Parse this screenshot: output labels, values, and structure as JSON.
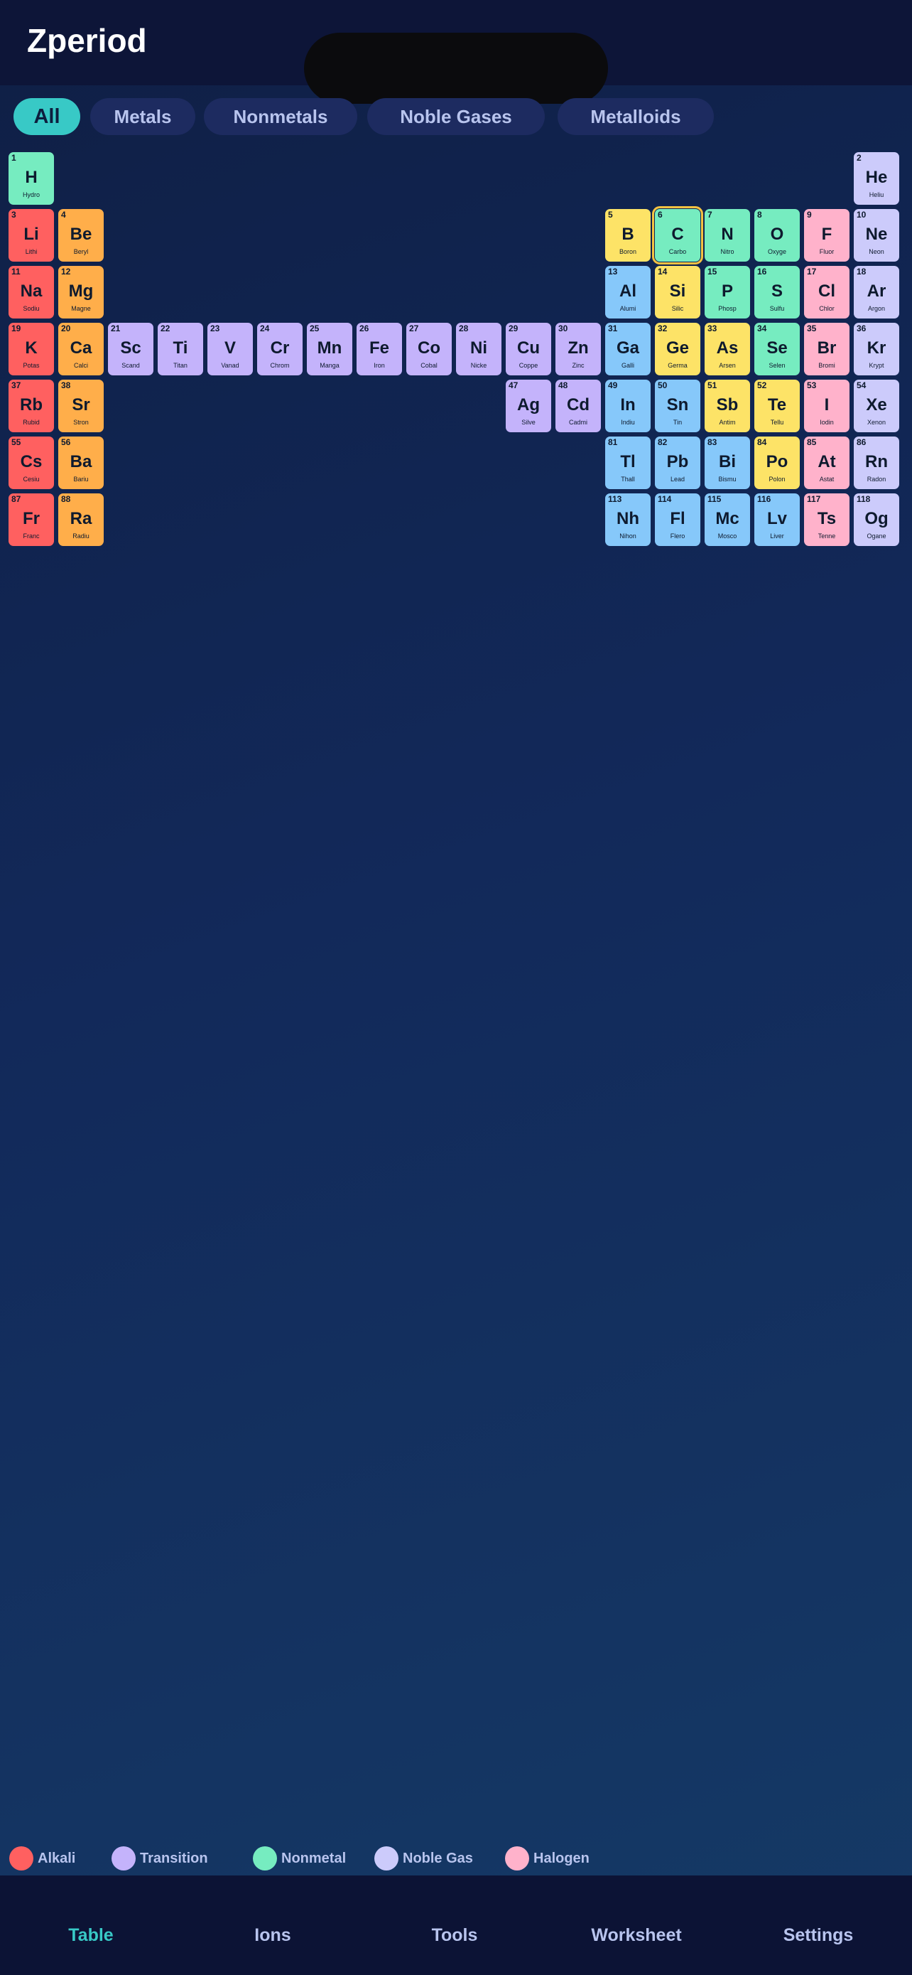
{
  "app": {
    "title": "Zperiod"
  },
  "filters": [
    {
      "label": "All",
      "active": true
    },
    {
      "label": "Metals",
      "active": false
    },
    {
      "label": "Nonmetals",
      "active": false
    },
    {
      "label": "Noble Gases",
      "active": false
    },
    {
      "label": "Metalloids",
      "active": false
    }
  ],
  "colors": {
    "alkali": "#ff6060",
    "alkaline": "#ffae4a",
    "transition": "#c4b3fb",
    "post": "#86c8fa",
    "metalloid": "#fde367",
    "nonmetal": "#76ecc0",
    "halogen": "#ffb2cb",
    "noble": "#cccbfb"
  },
  "selected_element": "C",
  "elements": [
    {
      "n": "1",
      "s": "H",
      "name": "Hydro",
      "c": "nonmetal",
      "row": 1,
      "col": 1
    },
    {
      "n": "2",
      "s": "He",
      "name": "Heliu",
      "c": "noble",
      "row": 1,
      "col": 18
    },
    {
      "n": "3",
      "s": "Li",
      "name": "Lithi",
      "c": "alkali",
      "row": 2,
      "col": 1
    },
    {
      "n": "4",
      "s": "Be",
      "name": "Beryl",
      "c": "alkaline",
      "row": 2,
      "col": 2
    },
    {
      "n": "5",
      "s": "B",
      "name": "Boron",
      "c": "metalloid",
      "row": 2,
      "col": 13
    },
    {
      "n": "6",
      "s": "C",
      "name": "Carbo",
      "c": "nonmetal",
      "row": 2,
      "col": 14
    },
    {
      "n": "7",
      "s": "N",
      "name": "Nitro",
      "c": "nonmetal",
      "row": 2,
      "col": 15
    },
    {
      "n": "8",
      "s": "O",
      "name": "Oxyge",
      "c": "nonmetal",
      "row": 2,
      "col": 16
    },
    {
      "n": "9",
      "s": "F",
      "name": "Fluor",
      "c": "halogen",
      "row": 2,
      "col": 17
    },
    {
      "n": "10",
      "s": "Ne",
      "name": "Neon",
      "c": "noble",
      "row": 2,
      "col": 18
    },
    {
      "n": "11",
      "s": "Na",
      "name": "Sodiu",
      "c": "alkali",
      "row": 3,
      "col": 1
    },
    {
      "n": "12",
      "s": "Mg",
      "name": "Magne",
      "c": "alkaline",
      "row": 3,
      "col": 2
    },
    {
      "n": "13",
      "s": "Al",
      "name": "Alumi",
      "c": "post",
      "row": 3,
      "col": 13
    },
    {
      "n": "14",
      "s": "Si",
      "name": "Silic",
      "c": "metalloid",
      "row": 3,
      "col": 14
    },
    {
      "n": "15",
      "s": "P",
      "name": "Phosp",
      "c": "nonmetal",
      "row": 3,
      "col": 15
    },
    {
      "n": "16",
      "s": "S",
      "name": "Sulfu",
      "c": "nonmetal",
      "row": 3,
      "col": 16
    },
    {
      "n": "17",
      "s": "Cl",
      "name": "Chlor",
      "c": "halogen",
      "row": 3,
      "col": 17
    },
    {
      "n": "18",
      "s": "Ar",
      "name": "Argon",
      "c": "noble",
      "row": 3,
      "col": 18
    },
    {
      "n": "19",
      "s": "K",
      "name": "Potas",
      "c": "alkali",
      "row": 4,
      "col": 1
    },
    {
      "n": "20",
      "s": "Ca",
      "name": "Calci",
      "c": "alkaline",
      "row": 4,
      "col": 2
    },
    {
      "n": "21",
      "s": "Sc",
      "name": "Scand",
      "c": "transition",
      "row": 4,
      "col": 3
    },
    {
      "n": "22",
      "s": "Ti",
      "name": "Titan",
      "c": "transition",
      "row": 4,
      "col": 4
    },
    {
      "n": "23",
      "s": "V",
      "name": "Vanad",
      "c": "transition",
      "row": 4,
      "col": 5
    },
    {
      "n": "24",
      "s": "Cr",
      "name": "Chrom",
      "c": "transition",
      "row": 4,
      "col": 6
    },
    {
      "n": "25",
      "s": "Mn",
      "name": "Manga",
      "c": "transition",
      "row": 4,
      "col": 7
    },
    {
      "n": "26",
      "s": "Fe",
      "name": "Iron",
      "c": "transition",
      "row": 4,
      "col": 8
    },
    {
      "n": "27",
      "s": "Co",
      "name": "Cobal",
      "c": "transition",
      "row": 4,
      "col": 9
    },
    {
      "n": "28",
      "s": "Ni",
      "name": "Nicke",
      "c": "transition",
      "row": 4,
      "col": 10
    },
    {
      "n": "29",
      "s": "Cu",
      "name": "Coppe",
      "c": "transition",
      "row": 4,
      "col": 11
    },
    {
      "n": "30",
      "s": "Zn",
      "name": "Zinc",
      "c": "transition",
      "row": 4,
      "col": 12
    },
    {
      "n": "31",
      "s": "Ga",
      "name": "Galli",
      "c": "post",
      "row": 4,
      "col": 13
    },
    {
      "n": "32",
      "s": "Ge",
      "name": "Germa",
      "c": "metalloid",
      "row": 4,
      "col": 14
    },
    {
      "n": "33",
      "s": "As",
      "name": "Arsen",
      "c": "metalloid",
      "row": 4,
      "col": 15
    },
    {
      "n": "34",
      "s": "Se",
      "name": "Selen",
      "c": "nonmetal",
      "row": 4,
      "col": 16
    },
    {
      "n": "35",
      "s": "Br",
      "name": "Bromi",
      "c": "halogen",
      "row": 4,
      "col": 17
    },
    {
      "n": "36",
      "s": "Kr",
      "name": "Krypt",
      "c": "noble",
      "row": 4,
      "col": 18
    },
    {
      "n": "37",
      "s": "Rb",
      "name": "Rubid",
      "c": "alkali",
      "row": 5,
      "col": 1
    },
    {
      "n": "38",
      "s": "Sr",
      "name": "Stron",
      "c": "alkaline",
      "row": 5,
      "col": 2
    },
    {
      "n": "47",
      "s": "Ag",
      "name": "Silve",
      "c": "transition",
      "row": 5,
      "col": 11
    },
    {
      "n": "48",
      "s": "Cd",
      "name": "Cadmi",
      "c": "transition",
      "row": 5,
      "col": 12
    },
    {
      "n": "49",
      "s": "In",
      "name": "Indiu",
      "c": "post",
      "row": 5,
      "col": 13
    },
    {
      "n": "50",
      "s": "Sn",
      "name": "Tin",
      "c": "post",
      "row": 5,
      "col": 14
    },
    {
      "n": "51",
      "s": "Sb",
      "name": "Antim",
      "c": "metalloid",
      "row": 5,
      "col": 15
    },
    {
      "n": "52",
      "s": "Te",
      "name": "Tellu",
      "c": "metalloid",
      "row": 5,
      "col": 16
    },
    {
      "n": "53",
      "s": "I",
      "name": "Iodin",
      "c": "halogen",
      "row": 5,
      "col": 17
    },
    {
      "n": "54",
      "s": "Xe",
      "name": "Xenon",
      "c": "noble",
      "row": 5,
      "col": 18
    },
    {
      "n": "55",
      "s": "Cs",
      "name": "Cesiu",
      "c": "alkali",
      "row": 6,
      "col": 1
    },
    {
      "n": "56",
      "s": "Ba",
      "name": "Bariu",
      "c": "alkaline",
      "row": 6,
      "col": 2
    },
    {
      "n": "81",
      "s": "Tl",
      "name": "Thall",
      "c": "post",
      "row": 6,
      "col": 13
    },
    {
      "n": "82",
      "s": "Pb",
      "name": "Lead",
      "c": "post",
      "row": 6,
      "col": 14
    },
    {
      "n": "83",
      "s": "Bi",
      "name": "Bismu",
      "c": "post",
      "row": 6,
      "col": 15
    },
    {
      "n": "84",
      "s": "Po",
      "name": "Polon",
      "c": "metalloid",
      "row": 6,
      "col": 16
    },
    {
      "n": "85",
      "s": "At",
      "name": "Astat",
      "c": "halogen",
      "row": 6,
      "col": 17
    },
    {
      "n": "86",
      "s": "Rn",
      "name": "Radon",
      "c": "noble",
      "row": 6,
      "col": 18
    },
    {
      "n": "87",
      "s": "Fr",
      "name": "Franc",
      "c": "alkali",
      "row": 7,
      "col": 1
    },
    {
      "n": "88",
      "s": "Ra",
      "name": "Radiu",
      "c": "alkaline",
      "row": 7,
      "col": 2
    },
    {
      "n": "113",
      "s": "Nh",
      "name": "Nihon",
      "c": "post",
      "row": 7,
      "col": 13
    },
    {
      "n": "114",
      "s": "Fl",
      "name": "Flero",
      "c": "post",
      "row": 7,
      "col": 14
    },
    {
      "n": "115",
      "s": "Mc",
      "name": "Mosco",
      "c": "post",
      "row": 7,
      "col": 15
    },
    {
      "n": "116",
      "s": "Lv",
      "name": "Liver",
      "c": "post",
      "row": 7,
      "col": 16
    },
    {
      "n": "117",
      "s": "Ts",
      "name": "Tenne",
      "c": "halogen",
      "row": 7,
      "col": 17
    },
    {
      "n": "118",
      "s": "Og",
      "name": "Ogane",
      "c": "noble",
      "row": 7,
      "col": 18
    }
  ],
  "legend": [
    {
      "label": "Alkali",
      "color": "#ff6060"
    },
    {
      "label": "Transition",
      "color": "#c4b3fb"
    },
    {
      "label": "Nonmetal",
      "color": "#76ecc0"
    },
    {
      "label": "Noble Gas",
      "color": "#cccbfb"
    },
    {
      "label": "Halogen",
      "color": "#ffb2cb"
    }
  ],
  "tabs": [
    {
      "label": "Table",
      "active": true
    },
    {
      "label": "Ions",
      "active": false
    },
    {
      "label": "Tools",
      "active": false
    },
    {
      "label": "Worksheet",
      "active": false
    },
    {
      "label": "Settings",
      "active": false
    }
  ]
}
